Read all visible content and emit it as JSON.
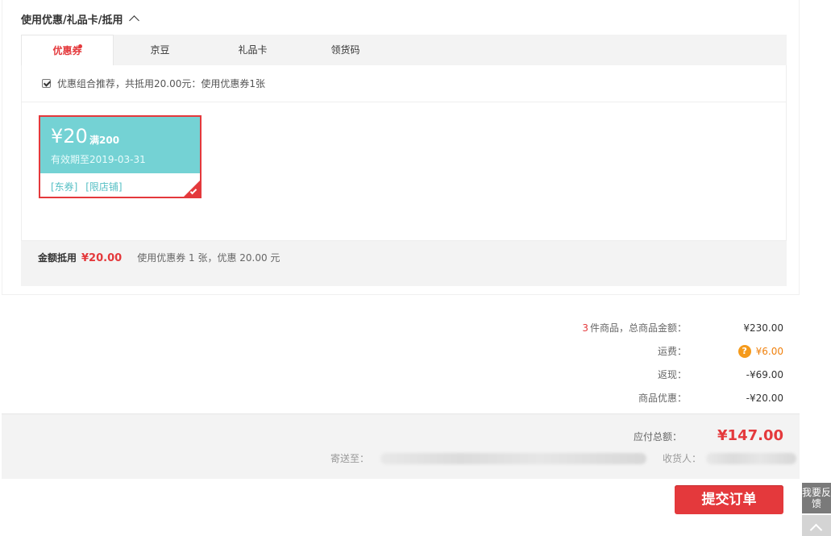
{
  "discount_section": {
    "title": "使用优惠/礼品卡/抵用",
    "tabs": [
      {
        "label": "优惠券",
        "active": true,
        "has_dot": true
      },
      {
        "label": "京豆",
        "active": false
      },
      {
        "label": "礼品卡",
        "active": false
      },
      {
        "label": "领货码",
        "active": false
      }
    ],
    "recommend_text": "优惠组合推荐，共抵用20.00元：使用优惠券1张",
    "recommend_checked": true,
    "coupon": {
      "amount": "¥20",
      "condition": "满200",
      "validity": "有效期至2019-03-31",
      "tags": [
        "[东券]",
        "[限店铺]"
      ],
      "selected": true
    },
    "summary": {
      "label": "金额抵用",
      "amount": "¥20.00",
      "detail": "使用优惠券 1 张，优惠 20.00 元"
    }
  },
  "fees": {
    "item_count": "3",
    "goods_label": "件商品，总商品金额：",
    "goods_amount": "¥230.00",
    "shipping_label": "运费：",
    "shipping_amount": "¥6.00",
    "shipping_help_icon": "?",
    "cashback_label": "返现：",
    "cashback_amount": "-¥69.00",
    "discount_label": "商品优惠：",
    "discount_amount": "-¥20.00"
  },
  "total": {
    "label": "应付总额：",
    "amount": "¥147.00",
    "ship_to_label": "寄送至：",
    "receiver_label": "收货人："
  },
  "submit_label": "提交订单",
  "side": {
    "feedback_label": "我要反馈"
  },
  "colors": {
    "accent_red": "#e4393c",
    "coupon_teal": "#74d2d4",
    "shipping_orange": "#f0800c"
  }
}
